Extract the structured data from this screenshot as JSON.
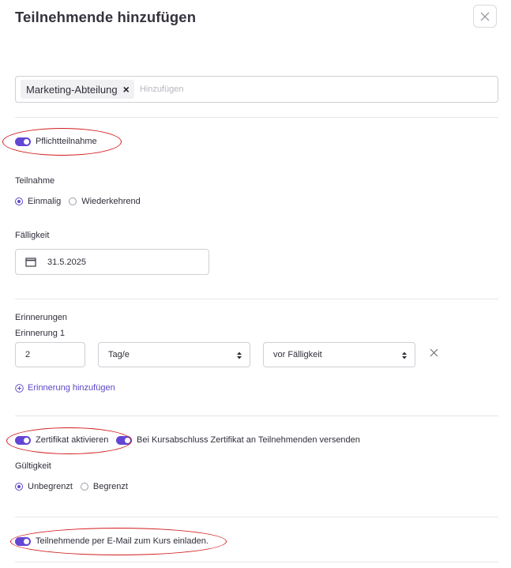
{
  "dialog": {
    "title": "Teilnehmende hinzufügen"
  },
  "participants": {
    "tags": [
      "Marketing-Abteilung"
    ],
    "placeholder": "Hinzufügen"
  },
  "mandatory": {
    "label": "Pflichtteilnahme",
    "enabled": true
  },
  "participation": {
    "label": "Teilnahme",
    "options": [
      "Einmalig",
      "Wiederkehrend"
    ],
    "selected": "Einmalig"
  },
  "due": {
    "label": "Fälligkeit",
    "date": "31.5.2025"
  },
  "reminders": {
    "label": "Erinnerungen",
    "items": [
      {
        "label": "Erinnerung 1",
        "amount": "2",
        "unit": "Tag/e",
        "relation": "vor Fälligkeit"
      }
    ],
    "add_label": "Erinnerung hinzufügen"
  },
  "certificate": {
    "enable_label": "Zertifikat aktivieren",
    "enable": true,
    "send_label": "Bei Kursabschluss Zertifikat an Teilnehmenden versenden",
    "send": true,
    "validity_label": "Gültigkeit",
    "validity_options": [
      "Unbegrenzt",
      "Begrenzt"
    ],
    "validity_selected": "Unbegrenzt"
  },
  "invite": {
    "label": "Teilnehmende per E-Mail zum Kurs einladen.",
    "enabled": true
  },
  "colors": {
    "accent": "#6246d4",
    "annotation": "#d21b1b"
  }
}
